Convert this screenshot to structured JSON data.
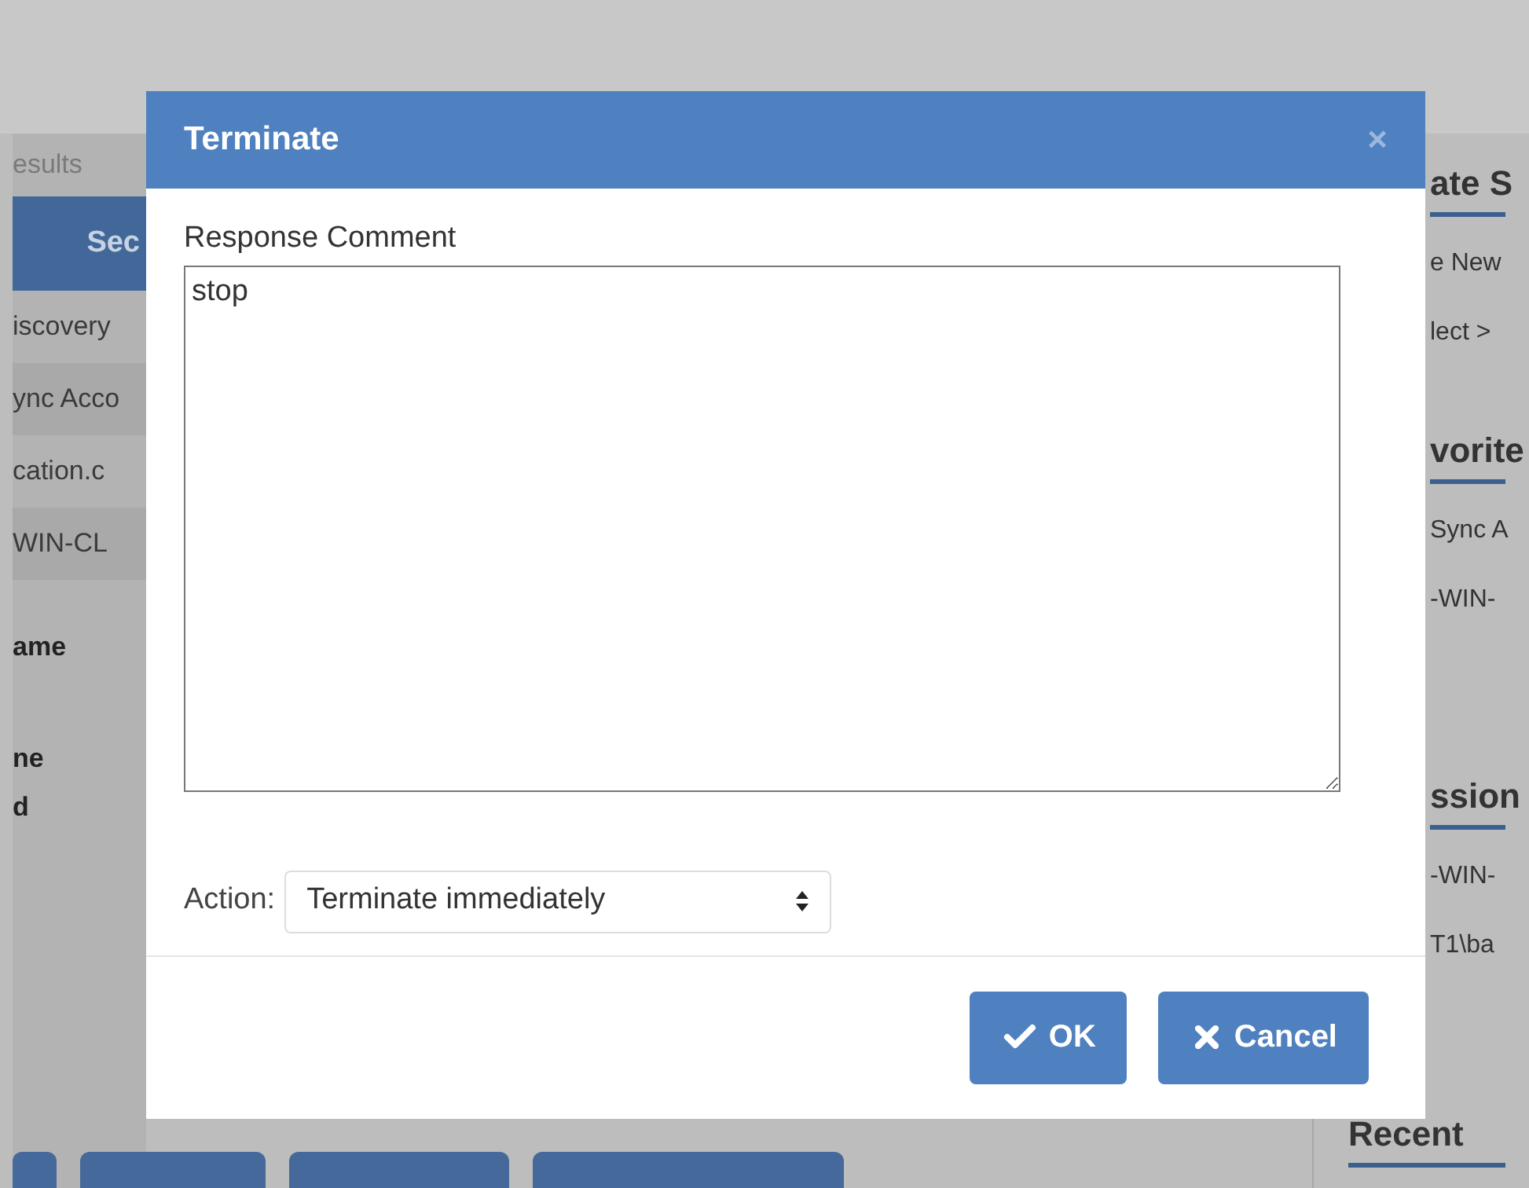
{
  "left_panel": {
    "tab_label": "esults",
    "header": "Sec",
    "rows": [
      "iscovery",
      "ync Acco",
      "cation.c",
      "WIN-CL"
    ],
    "fields": [
      {
        "label": "ame"
      },
      {
        "label": "ne"
      },
      {
        "label": "d"
      }
    ]
  },
  "right_panel": {
    "sections": [
      {
        "heading": "ate S",
        "lines": [
          "e New",
          "lect >"
        ]
      },
      {
        "heading": "vorite",
        "lines": [
          "Sync A",
          "-WIN-"
        ]
      },
      {
        "heading": "ssion",
        "lines": [
          "-WIN-",
          "T1\\ba"
        ]
      },
      {
        "heading": "Recent"
      }
    ]
  },
  "dialog": {
    "title": "Terminate",
    "close": "×",
    "comment_label": "Response Comment",
    "comment_value": "stop",
    "action_label": "Action:",
    "action_value": "Terminate immediately",
    "buttons": [
      {
        "kind": "ok",
        "label": "OK"
      },
      {
        "kind": "cancel",
        "label": "Cancel"
      }
    ]
  }
}
